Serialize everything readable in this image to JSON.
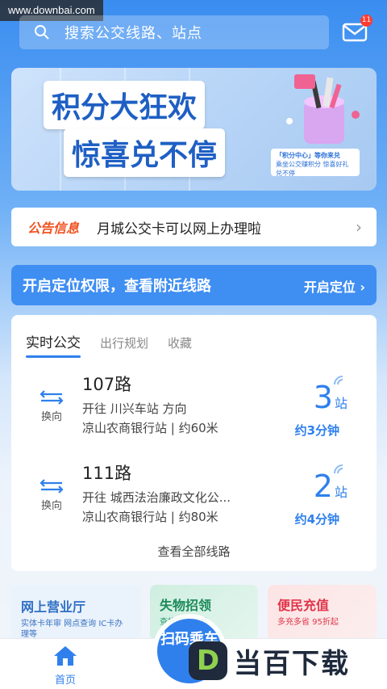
{
  "watermark": {
    "site": "www.downbai.com"
  },
  "search": {
    "placeholder": "搜索公交线路、站点",
    "icon": "search-icon"
  },
  "mail": {
    "badge": "11",
    "icon": "mail-icon"
  },
  "banner": {
    "line1": "积分大狂欢",
    "line2": "惊喜兑不停",
    "promo_title": "「积分中心」等你来兑",
    "promo_sub": "乘坐公交赚积分 惊喜好礼兑不停"
  },
  "notice": {
    "label": "公告信息",
    "text": "月城公交卡可以网上办理啦"
  },
  "location": {
    "text": "开启定位权限，查看附近线路",
    "button": "开启定位"
  },
  "realtime": {
    "tabs": [
      "实时公交",
      "出行规划",
      "收藏"
    ],
    "swap_label": "换向",
    "routes": [
      {
        "name": "107路",
        "direction": "开往 川兴车站 方向",
        "stop": "凉山农商银行站 | 约60米",
        "count": "3",
        "unit": "站",
        "eta": "约3分钟"
      },
      {
        "name": "111路",
        "direction": "开往 城西法治廉政文化公...",
        "stop": "凉山农商银行站 | 约80米",
        "count": "2",
        "unit": "站",
        "eta": "约4分钟"
      }
    ],
    "view_all": "查看全部线路"
  },
  "services": [
    {
      "title": "网上营业厅",
      "sub": "实体卡年审 网点查询 IC卡办理等"
    },
    {
      "title": "失物招领",
      "sub": "查找丢失物品"
    },
    {
      "title": "便民充值",
      "sub": "多充多省 95折起"
    }
  ],
  "tabbar": {
    "home": "首页",
    "scan": "扫码乘车"
  },
  "brand": {
    "logo_letter": "D",
    "logo_text": "当百下载"
  },
  "colors": {
    "primary": "#2f80ed",
    "notice_label": "#f0521f",
    "badge": "#ff3b30"
  }
}
